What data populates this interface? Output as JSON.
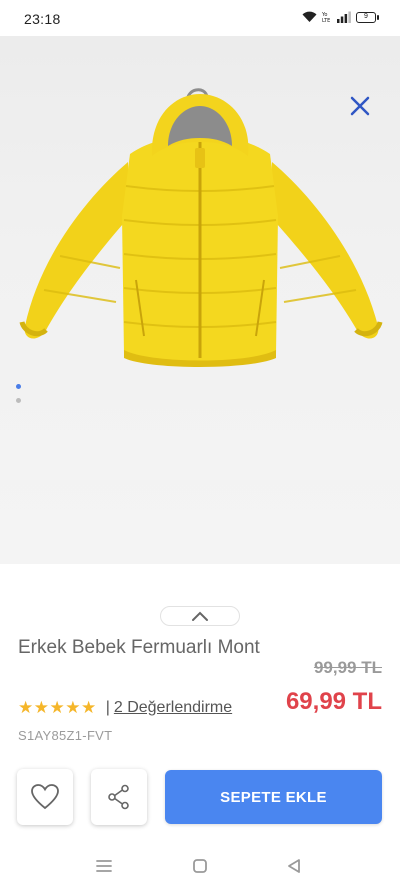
{
  "status_bar": {
    "time": "23:18",
    "battery": "9",
    "icons": [
      "wifi-icon",
      "volte-icon",
      "signal-icon",
      "battery-icon"
    ]
  },
  "product": {
    "title": "Erkek Bebek Fermuarlı Mont",
    "old_price": "99,99 TL",
    "new_price": "69,99 TL",
    "stars": "★★★★★",
    "rating_separator": "|",
    "reviews_link": "2 Değerlendirme",
    "code": "S1AY85Z1-FVT",
    "rating": 5
  },
  "gallery": {
    "image_count": 2,
    "active_index": 0
  },
  "actions": {
    "add_to_cart": "SEPETE EKLE"
  },
  "colors": {
    "accent": "#4a86f0",
    "price": "#e0434b",
    "stars": "#f5b62a",
    "jacket": "#f5d622"
  },
  "nav": {
    "icons": [
      "menu-icon",
      "home-square-icon",
      "back-triangle-icon"
    ]
  }
}
